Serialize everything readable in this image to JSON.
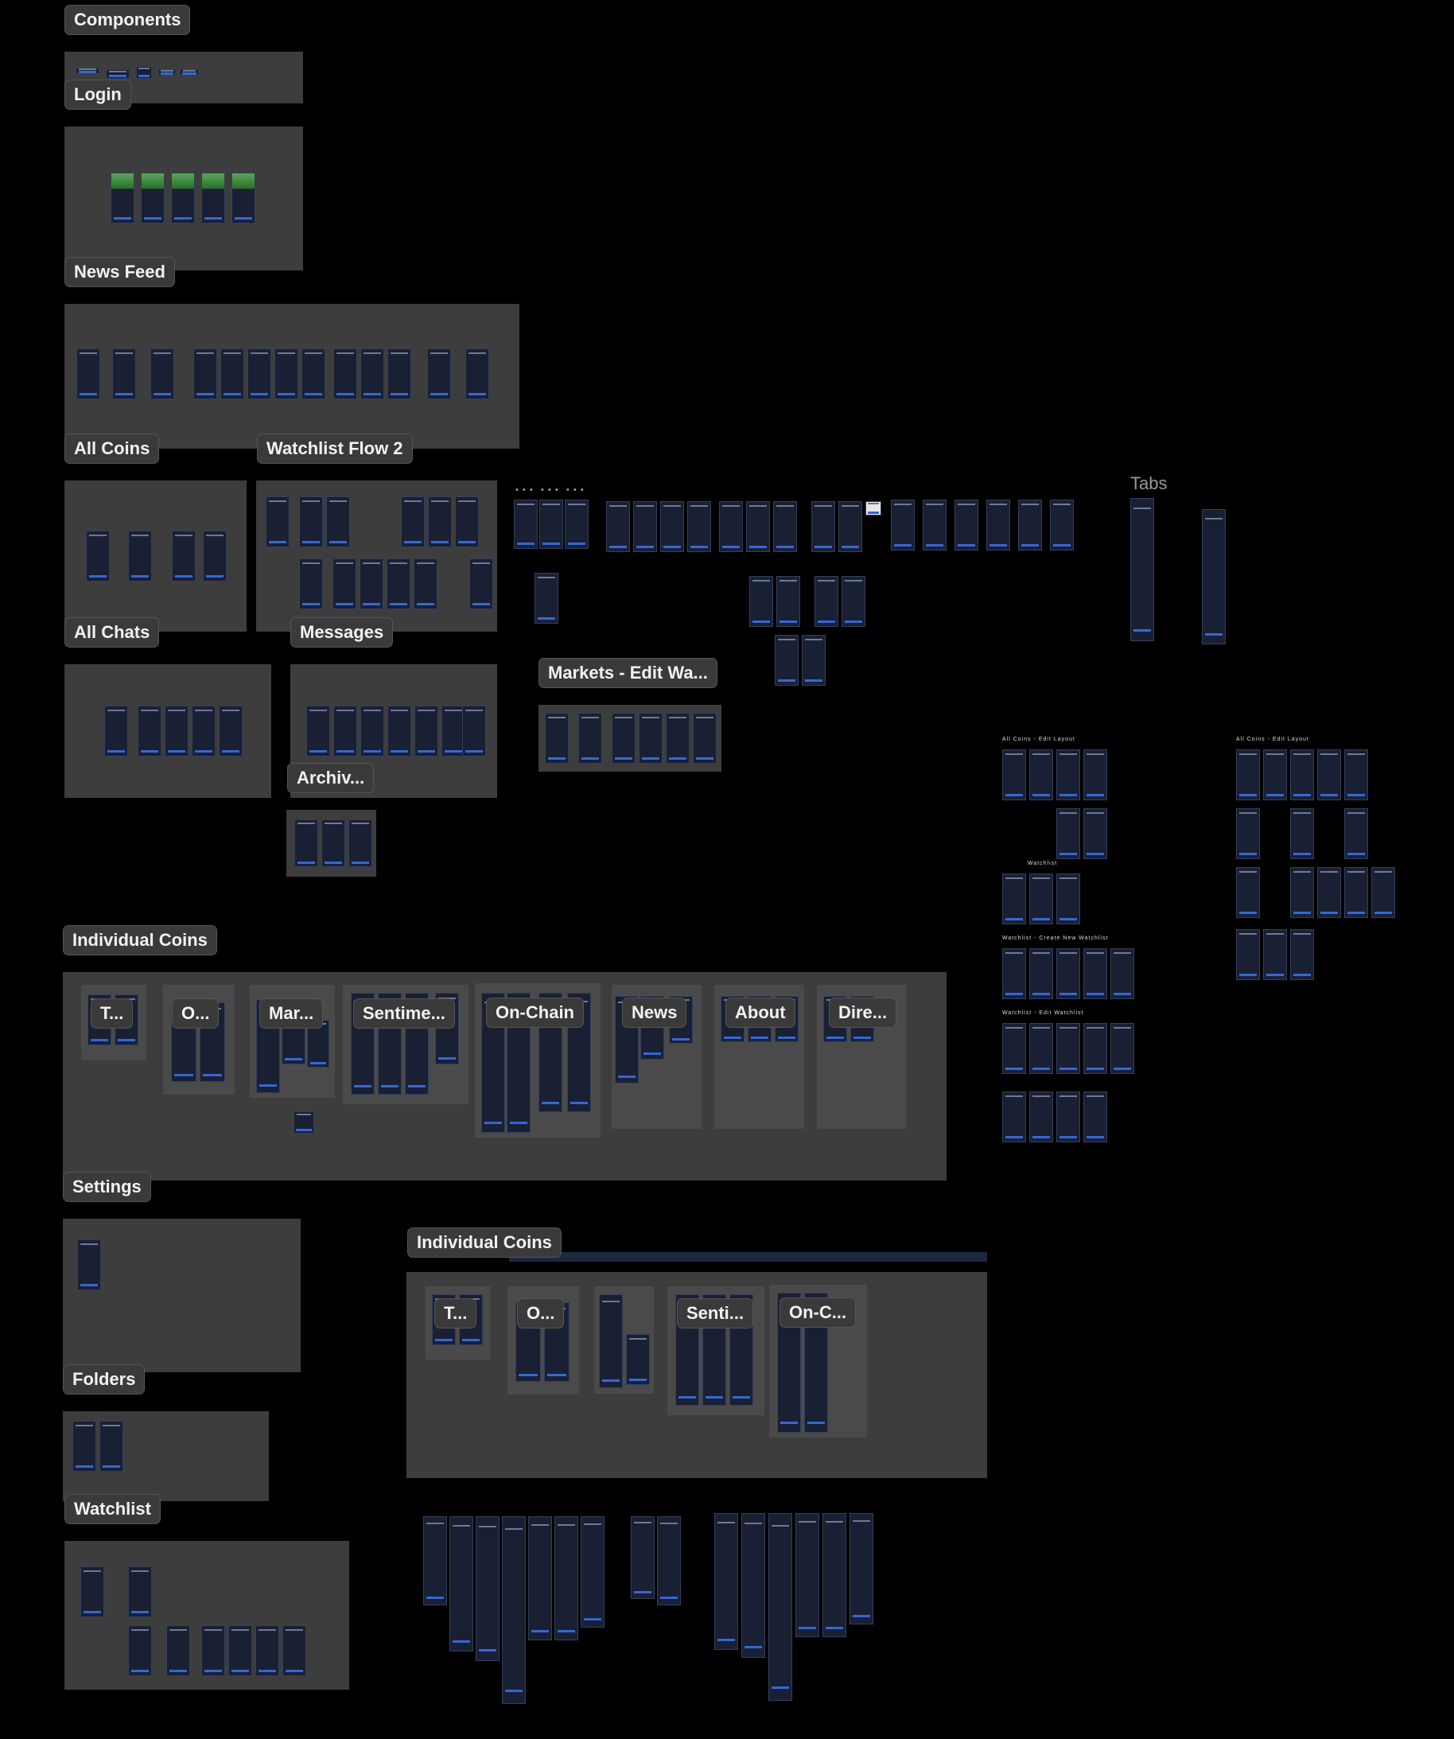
{
  "canvas": {
    "background": "#000000",
    "frame_color": "#3d3d3d",
    "screen_color": "#1a2033",
    "accent": "#3567d6"
  },
  "frames": {
    "components": "Components",
    "login": "Login",
    "news_feed": "News Feed",
    "all_coins": "All Coins",
    "watchlist_flow_2": "Watchlist Flow 2",
    "all_chats": "All Chats",
    "messages": "Messages",
    "markets_edit": "Markets - Edit Wa...",
    "archive": "Archiv...",
    "individual_coins": "Individual Coins",
    "settings": "Settings",
    "individual_coins_2": "Individual Coins",
    "folders": "Folders",
    "watchlist": "Watchlist",
    "tabs": "Tabs"
  },
  "sub_frames_1": {
    "t": "T...",
    "o": "O...",
    "mar": "Mar...",
    "sentiment": "Sentime...",
    "onchain": "On-Chain",
    "news": "News",
    "about": "About",
    "dire": "Dire..."
  },
  "sub_frames_2": {
    "t": "T...",
    "o": "O...",
    "senti": "Senti...",
    "onc": "On-C..."
  },
  "small_captions": {
    "all_coins_edit_layout_1": "All Coins - Edit Layout",
    "all_coins_edit_layout_2": "All Coins - Edit Layout",
    "watchlist": "Watchlist",
    "watchlist_create": "Watchlist - Create New Watchlist",
    "watchlist_edit": "Watchlist - Edit Watchlist"
  },
  "dots": "• • •"
}
